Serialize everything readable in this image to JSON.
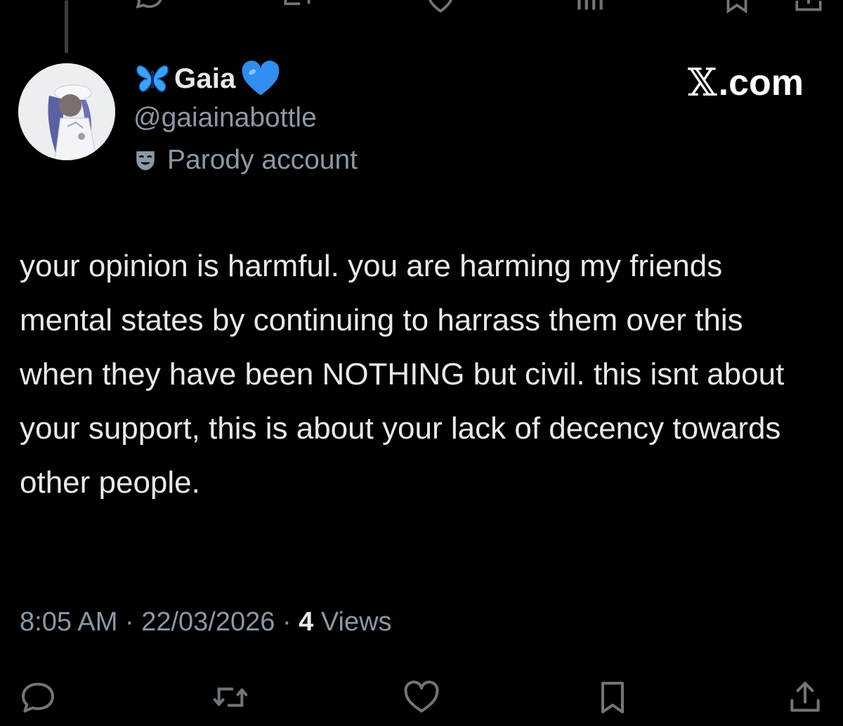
{
  "author": {
    "display_name": "Gaia",
    "handle": "@gaiainabottle",
    "label": "Parody account",
    "name_prefix_icon": "butterfly-emoji",
    "name_suffix_icon": "blue-heart-emoji",
    "label_icon": "theater-mask-icon"
  },
  "brand": {
    "text": ".com",
    "glyph": "𝕏"
  },
  "tweet": {
    "text": "your opinion is harmful. you are harming my friends mental states by continuing to harrass them over this when they have been NOTHING but civil. this isnt about your support, this is about your lack of decency towards other people."
  },
  "meta": {
    "time": "8:05 AM",
    "separator": " · ",
    "date": "22/03/2026",
    "views_count": "4",
    "views_label": " Views"
  },
  "actions": {
    "reply_icon": "reply-icon",
    "retweet_icon": "retweet-icon",
    "like_icon": "heart-icon",
    "bookmark_icon": "bookmark-icon",
    "share_icon": "share-icon"
  },
  "colors": {
    "background": "#000000",
    "text": "#e7e9ea",
    "secondary_text": "#8b98a5",
    "icon": "#71767b",
    "heart": "#2f8ef0",
    "butterfly": "#3aa3ff"
  }
}
